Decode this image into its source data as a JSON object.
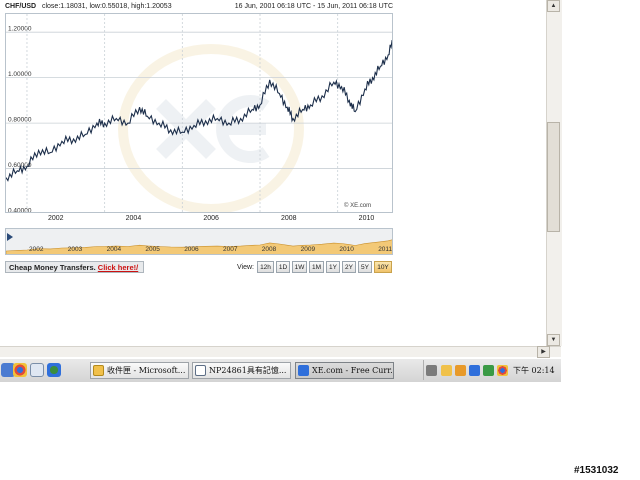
{
  "chart": {
    "symbol": "CHF/USD",
    "stats": "close:1.18031, low:0.55018, high:1.20053",
    "date_range": "16 Jun, 2001 06:18 UTC - 15 Jun, 2011 06:18 UTC",
    "y_tick_labels": [
      "1.20000",
      "1.00000",
      "0.80000",
      "0.60000",
      "0.40000"
    ],
    "x_tick_labels": [
      "2002",
      "2004",
      "2006",
      "2008",
      "2010"
    ],
    "copyright": "© XE.com",
    "line_color": "#1c2e4a"
  },
  "chart_data": {
    "type": "line",
    "title": "CHF/USD",
    "x_unit": "year",
    "ylim": [
      0.4,
      1.28
    ],
    "xlim": [
      2001.46,
      2011.45
    ],
    "grid": true,
    "series": [
      {
        "name": "CHF/USD",
        "x": [
          2001.46,
          2001.75,
          2002.0,
          2002.3,
          2002.6,
          2002.9,
          2003.2,
          2003.5,
          2003.8,
          2004.0,
          2004.3,
          2004.6,
          2004.9,
          2005.1,
          2005.4,
          2005.7,
          2006.0,
          2006.3,
          2006.6,
          2006.9,
          2007.2,
          2007.5,
          2007.8,
          2008.0,
          2008.25,
          2008.5,
          2008.7,
          2008.85,
          2009.1,
          2009.3,
          2009.6,
          2009.9,
          2010.1,
          2010.3,
          2010.45,
          2010.7,
          2010.9,
          2011.1,
          2011.3,
          2011.45
        ],
        "y": [
          0.56,
          0.59,
          0.61,
          0.68,
          0.67,
          0.72,
          0.73,
          0.75,
          0.8,
          0.8,
          0.82,
          0.8,
          0.87,
          0.83,
          0.8,
          0.77,
          0.76,
          0.79,
          0.81,
          0.82,
          0.8,
          0.82,
          0.86,
          0.88,
          0.99,
          0.93,
          0.87,
          0.82,
          0.86,
          0.88,
          0.92,
          0.98,
          0.96,
          0.9,
          0.85,
          0.95,
          1.0,
          1.05,
          1.1,
          1.18
        ]
      }
    ]
  },
  "overview": {
    "year_labels": [
      "2002",
      "2003",
      "2004",
      "2005",
      "2006",
      "2007",
      "2008",
      "2009",
      "2010",
      "2011"
    ],
    "fill_color": "#f3c977"
  },
  "controls": {
    "promo_text": "Cheap Money Transfers.",
    "promo_link": "Click here!/",
    "view_label": "View:",
    "view_buttons": [
      "12h",
      "1D",
      "1W",
      "1M",
      "1Y",
      "2Y",
      "5Y",
      "10Y"
    ],
    "active_view": "10Y"
  },
  "taskbar": {
    "items": [
      {
        "label": "收件匣 - Microsoft..."
      },
      {
        "label": "NP24861具有記憶..."
      },
      {
        "label": "XE.com - Free Curr..."
      }
    ],
    "clock": "下午 02:14"
  },
  "image_id": "#1531032"
}
